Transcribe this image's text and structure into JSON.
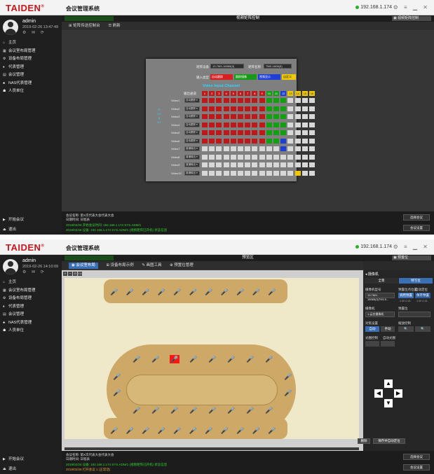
{
  "app": {
    "brand": "TAIDEN",
    "title": "会议管理系统",
    "ip": "192.168.1.174",
    "window_controls": "⚙ ≡ ▁ ✕"
  },
  "user": {
    "name": "admin",
    "time": "2019-02-26 13:47:49",
    "time2": "2019-02-26 14:10:09",
    "icons": "⚙ ✉ ⟳"
  },
  "menu": [
    {
      "icon": "⌂",
      "label": "主页"
    },
    {
      "icon": "▦",
      "label": "会议室布局管理"
    },
    {
      "icon": "⚙",
      "label": "设备布局管理"
    },
    {
      "icon": "♦",
      "label": "代表管理"
    },
    {
      "icon": "▤",
      "label": "会议管理"
    },
    {
      "icon": "♣",
      "label": "NAS代表管理"
    },
    {
      "icon": "☗",
      "label": "人员单位"
    }
  ],
  "sidebar_bottom": [
    {
      "icon": "▶",
      "label": "开始会议"
    },
    {
      "icon": "⏏",
      "label": "退出"
    }
  ],
  "shot1": {
    "greenbar": "",
    "window_title": "视频矩阵控制",
    "top_dropdown": "视频矩阵控制",
    "toolbar": [
      "⊞ 矩阵传送控制台",
      "☰ 刷新"
    ],
    "matrix": {
      "device_label": "矩阵设备",
      "device_value": "13.7MX-16065(3)",
      "name_label": "矩阵名称",
      "name_value": "TMX-1606(3)",
      "type_label": "输入类型",
      "type_buttons": [
        "自动跟踪",
        "跟踪镜像",
        "视频显示",
        "自定义"
      ],
      "video_input_title": "Video Input Channel",
      "col_header_label": "输出通道",
      "columns": [
        "1",
        "2",
        "3",
        "4",
        "5",
        "6",
        "7",
        "8",
        "9",
        "10",
        "11",
        "12",
        "13",
        "14",
        "15",
        "16"
      ],
      "output_label": "O u t p u t",
      "rows": [
        {
          "label": "Video1",
          "mode": "自动跟踪"
        },
        {
          "label": "Video2",
          "mode": "自动跟踪"
        },
        {
          "label": "Video3",
          "mode": "自动跟踪"
        },
        {
          "label": "Video4",
          "mode": "自动跟踪"
        },
        {
          "label": "Video5",
          "mode": "自动跟踪"
        },
        {
          "label": "Video6",
          "mode": "自动跟踪"
        },
        {
          "label": "Video7",
          "mode": "普通输出"
        },
        {
          "label": "Video8",
          "mode": "普通输出"
        },
        {
          "label": "Video9",
          "mode": "普通输出"
        },
        {
          "label": "Video10",
          "mode": "普通输出"
        }
      ]
    },
    "status": {
      "line1": "会议名称: 第X次代表大会代表大会",
      "line2": "日期时间: 日程表",
      "green1": "2019/02/26 开始会议时间: 192.168.1.174 SYS.ADM/1",
      "green2": "2019/02/26 设备: 192.168.1.174 SYS.ADM/1 (视频矩阵已开机) 状态信息",
      "btn1": "选择会议",
      "btn2": "会议设置"
    }
  },
  "shot2": {
    "greenbar": "",
    "window_title": "预览区",
    "top_dropdown": "预置位",
    "toolbar": [
      "◉ 会议室布局",
      "⊞ 设备布局示例",
      "✎ 画图工具",
      "⊕ 预置位管理"
    ],
    "zoom": [
      "＋",
      "－",
      "⊡",
      "1:1"
    ],
    "panel": {
      "head": "◂ 摄像机",
      "tabs": [
        "全景",
        "特写位"
      ],
      "device_label": "摄像机型号",
      "device_value": "13.7MX-16065(3)TK9-5...",
      "preset_label": "预置位点位置",
      "preset_auto": "自动定位",
      "btn_apply": "调用预置",
      "btn_save": "保存预置",
      "coord1": "1.00 0.21",
      "coord2": "1.00 0.21",
      "cam_label": "摄像机",
      "cam_value": "1-云台摄像机",
      "speed_label": "预置位",
      "focus_label": "对焦设置",
      "focus_auto": "自动",
      "focus_manual": "手动",
      "zoom_label": "缩放控制",
      "aperture_label": "光圈控制",
      "aperture_auto": "自动光圈",
      "delete_btn": "删除",
      "save_btn": "保存并自动定位",
      "arrows": [
        "▲",
        "◀",
        "▶",
        "▼"
      ]
    },
    "status": {
      "line1": "会议名称: 第X次代表大会代表大会",
      "line2": "日期时间: 日程表",
      "green1": "2019/02/26 设备: 192.168.1.174 SYS.ADM/1 (视频矩阵已开机) 状态信息",
      "green2": "2019/02/26 打开会议 1 (正常话)",
      "btn1": "选择会议",
      "btn2": "会议设置"
    }
  },
  "colors": {
    "brand_red": "#c8161d",
    "cell_red": "#c01818",
    "cell_green": "#10a010",
    "cell_blue": "#1e3fd6",
    "cell_yellow": "#f0c800",
    "cell_gray": "#d8d8d8",
    "accent_cyan": "#33d0ff"
  }
}
